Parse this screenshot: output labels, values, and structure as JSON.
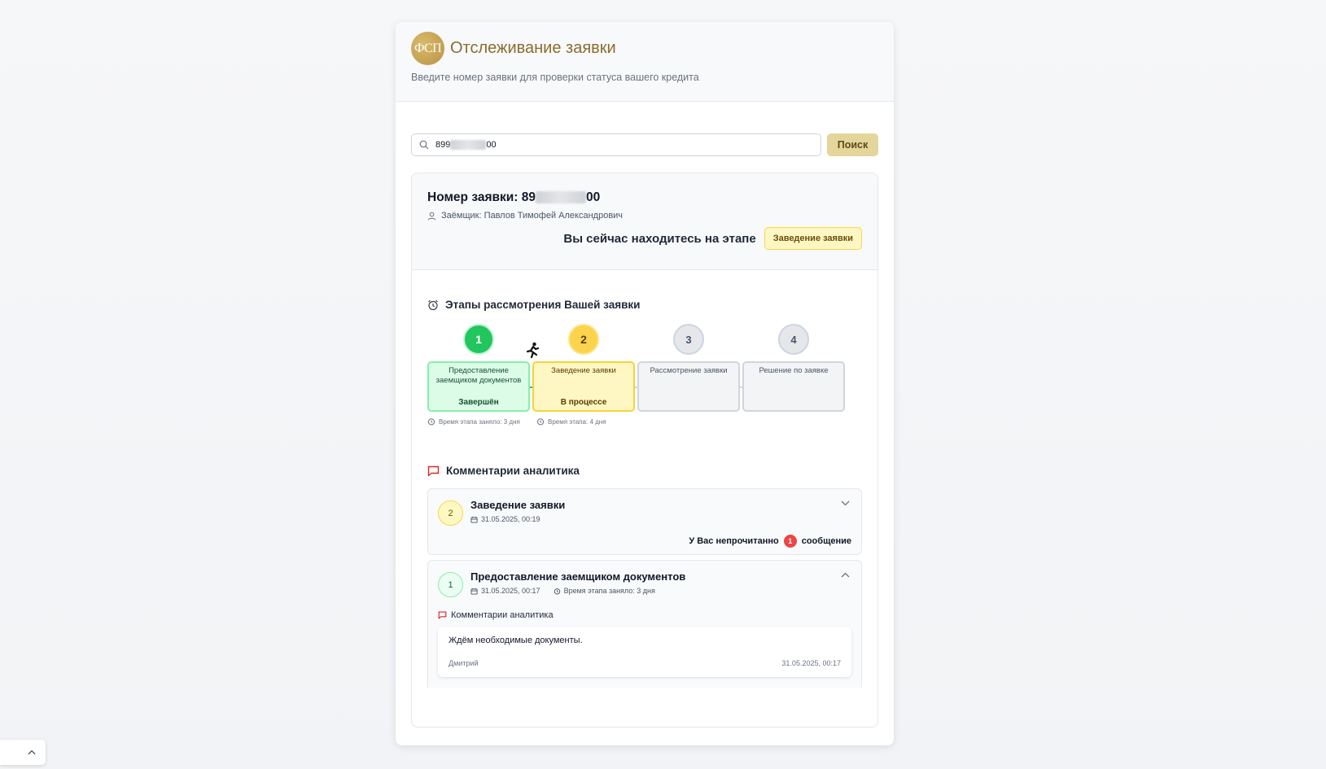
{
  "header": {
    "logo_text": "ФСП",
    "title": "Отслеживание заявки",
    "subtitle": "Введите номер заявки для проверки статуса вашего кредита"
  },
  "search": {
    "value_prefix": "899",
    "value_suffix": "00",
    "button_label": "Поиск"
  },
  "application": {
    "number_label": "Номер заявки: ",
    "number_prefix": "89",
    "number_suffix": "00",
    "borrower_label": "Заёмщик: ",
    "borrower_name": "Павлов Тимофей Александрович",
    "current_stage_label": "Вы сейчас находитесь на этапе",
    "current_stage": "Заведение заявки"
  },
  "stages": {
    "title": "Этапы рассмотрения Вашей заявки",
    "items": [
      {
        "num": "1",
        "label": "Предоставление заемщиком документов",
        "status": "Завершён",
        "time": "Время этапа заняло: 3 дня"
      },
      {
        "num": "2",
        "label": "Заведение заявки",
        "status": "В процессе",
        "time": "Время этапа: 4 дня"
      },
      {
        "num": "3",
        "label": "Рассмотрение заявки"
      },
      {
        "num": "4",
        "label": "Решение по заявке"
      }
    ]
  },
  "comments": {
    "title": "Комментарии аналитика",
    "items": [
      {
        "num": "2",
        "title": "Заведение заявки",
        "date": "31.05.2025, 00:19",
        "unread_prefix": "У Вас непрочитанно",
        "unread_count": "1",
        "unread_suffix": "сообщение"
      },
      {
        "num": "1",
        "title": "Предоставление заемщиком документов",
        "date": "31.05.2025, 00:17",
        "time": "Время этапа заняло: 3 дня",
        "sub_title": "Комментарии аналитика",
        "message": {
          "text": "Ждём необходимые документы.",
          "author": "Дмитрий",
          "date": "31.05.2025, 00:17"
        }
      }
    ]
  },
  "icons": {
    "search": "search-icon",
    "user": "user-icon",
    "alarm": "alarm-clock-icon",
    "comment": "chat-bubble-icon",
    "calendar": "calendar-icon",
    "runner": "running-person-icon",
    "chevron_down": "chevron-down-icon",
    "chevron_up": "chevron-up-icon"
  },
  "colors": {
    "brand": "#8a6d2d",
    "done": "#22c55e",
    "current": "#fcd34d",
    "pending": "#e5e7eb",
    "unread": "#ef4444",
    "comment_icon": "#dc2626"
  }
}
